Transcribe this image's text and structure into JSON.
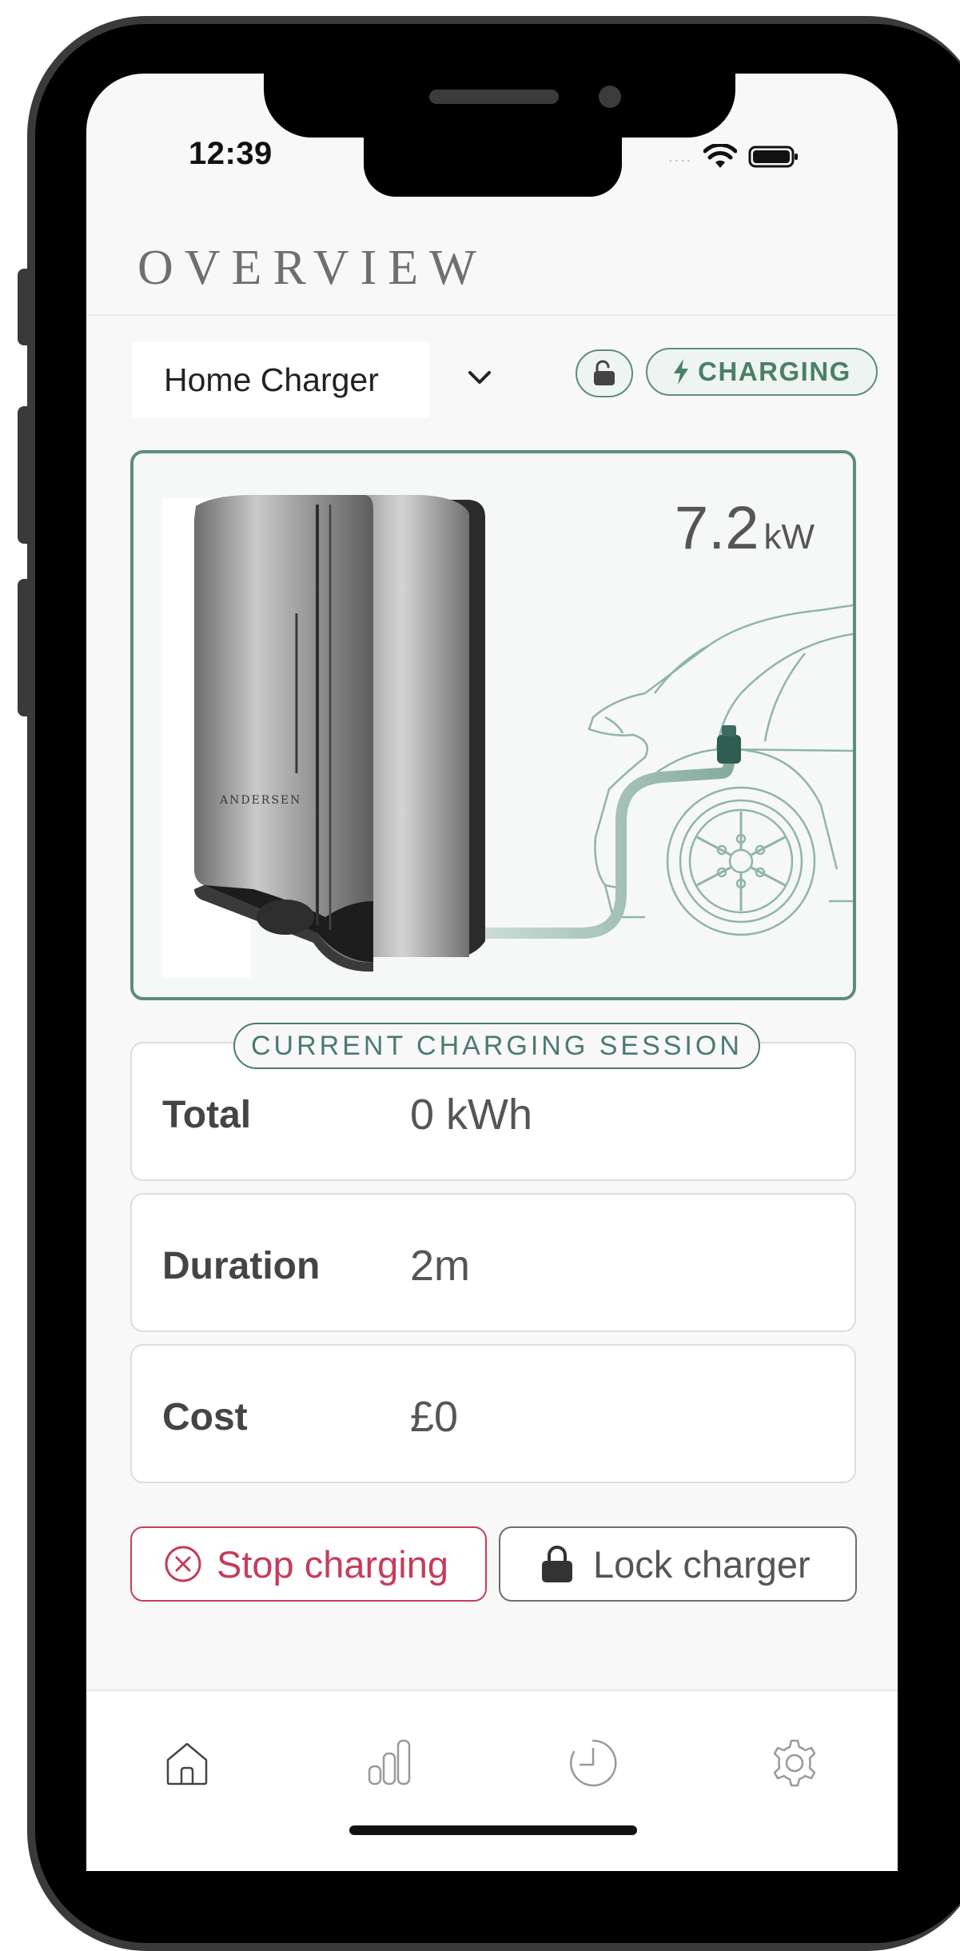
{
  "status_bar": {
    "time": "12:39",
    "signal": "....",
    "icons": [
      "wifi-icon",
      "battery-icon"
    ]
  },
  "header": {
    "title": "OVERVIEW"
  },
  "charger_selector": {
    "selected": "Home Charger",
    "icon": "chevron-down-icon"
  },
  "badges": {
    "lock_icon": "unlocked-padlock-icon",
    "status_label": "CHARGING",
    "status_icon": "bolt-icon"
  },
  "hero": {
    "power_value": "7.2",
    "power_unit": "kW",
    "brand": "ANDERSEN",
    "illustration": "charger-connected-to-car"
  },
  "session": {
    "label": "CURRENT CHARGING SESSION",
    "rows": [
      {
        "label": "Total",
        "value": "0 kWh"
      },
      {
        "label": "Duration",
        "value": "2m"
      },
      {
        "label": "Cost",
        "value": "£0"
      }
    ]
  },
  "actions": {
    "stop_label": "Stop charging",
    "lock_label": "Lock charger"
  },
  "tabbar": {
    "tabs": [
      "home-icon",
      "stats-icon",
      "history-icon",
      "settings-icon"
    ],
    "active": "home-icon"
  },
  "colors": {
    "accent": "#5c8e78",
    "danger": "#c63c5a",
    "background": "#f8f8f8"
  }
}
